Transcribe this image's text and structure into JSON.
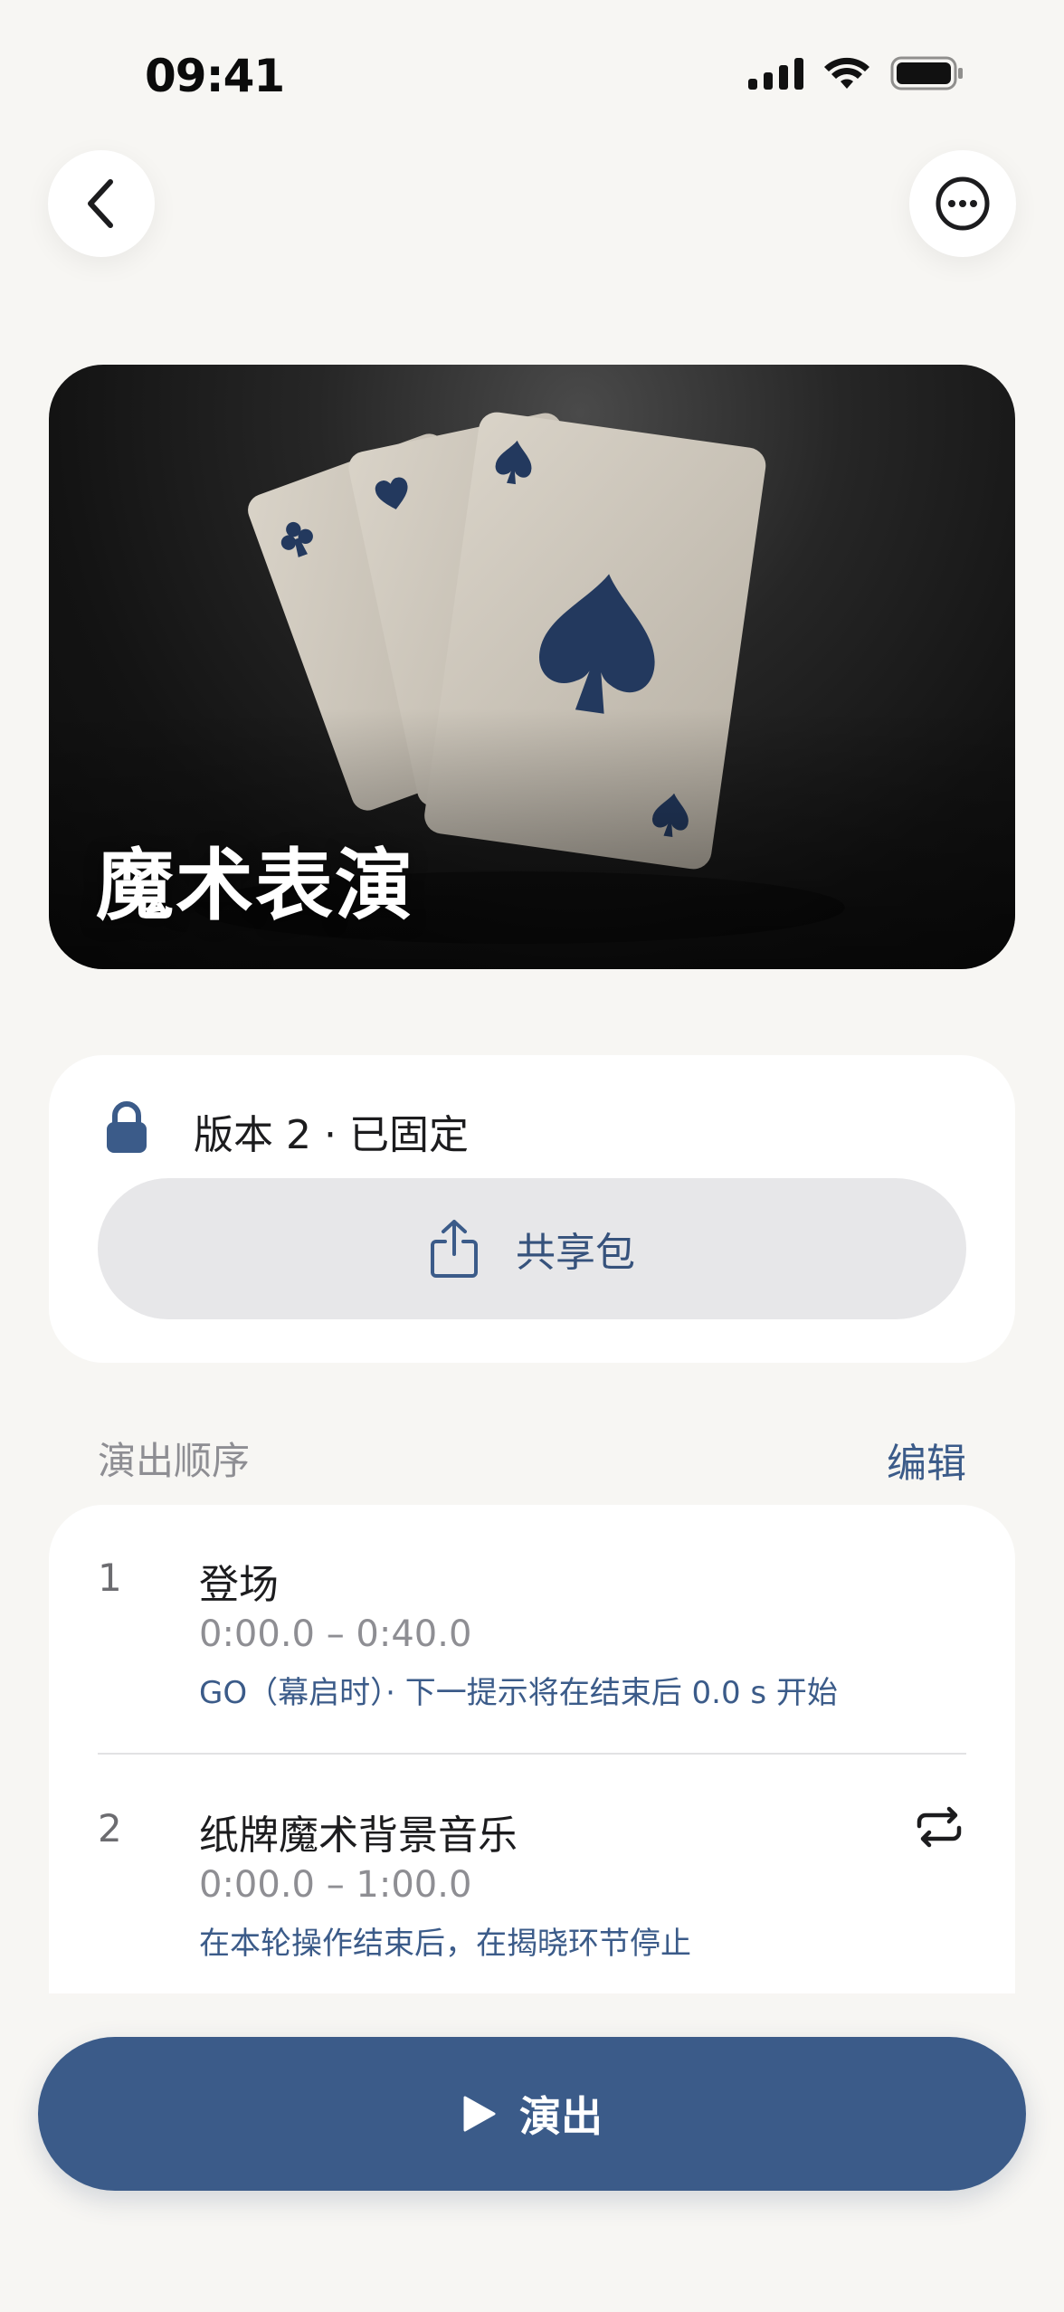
{
  "status_bar": {
    "time": "09:41"
  },
  "hero": {
    "title": "魔术表演"
  },
  "version": {
    "label": "版本 2 · 已固定",
    "share_label": "共享包"
  },
  "section": {
    "title": "演出顺序",
    "edit_label": "编辑"
  },
  "cues": [
    {
      "number": "1",
      "name": "登场",
      "time": "0:00.0 – 0:40.0",
      "note": "GO（幕启时）· 下一提示将在结束后 0.0 s 开始",
      "loop": false
    },
    {
      "number": "2",
      "name": "纸牌魔术背景音乐",
      "time": "0:00.0 – 1:00.0",
      "note": "在本轮操作结束后，在揭晓环节停止",
      "loop": true
    }
  ],
  "play_button": {
    "label": "演出"
  },
  "colors": {
    "accent": "#3b5b89",
    "card_ink": "#23395e",
    "background": "#f7f6f3"
  }
}
